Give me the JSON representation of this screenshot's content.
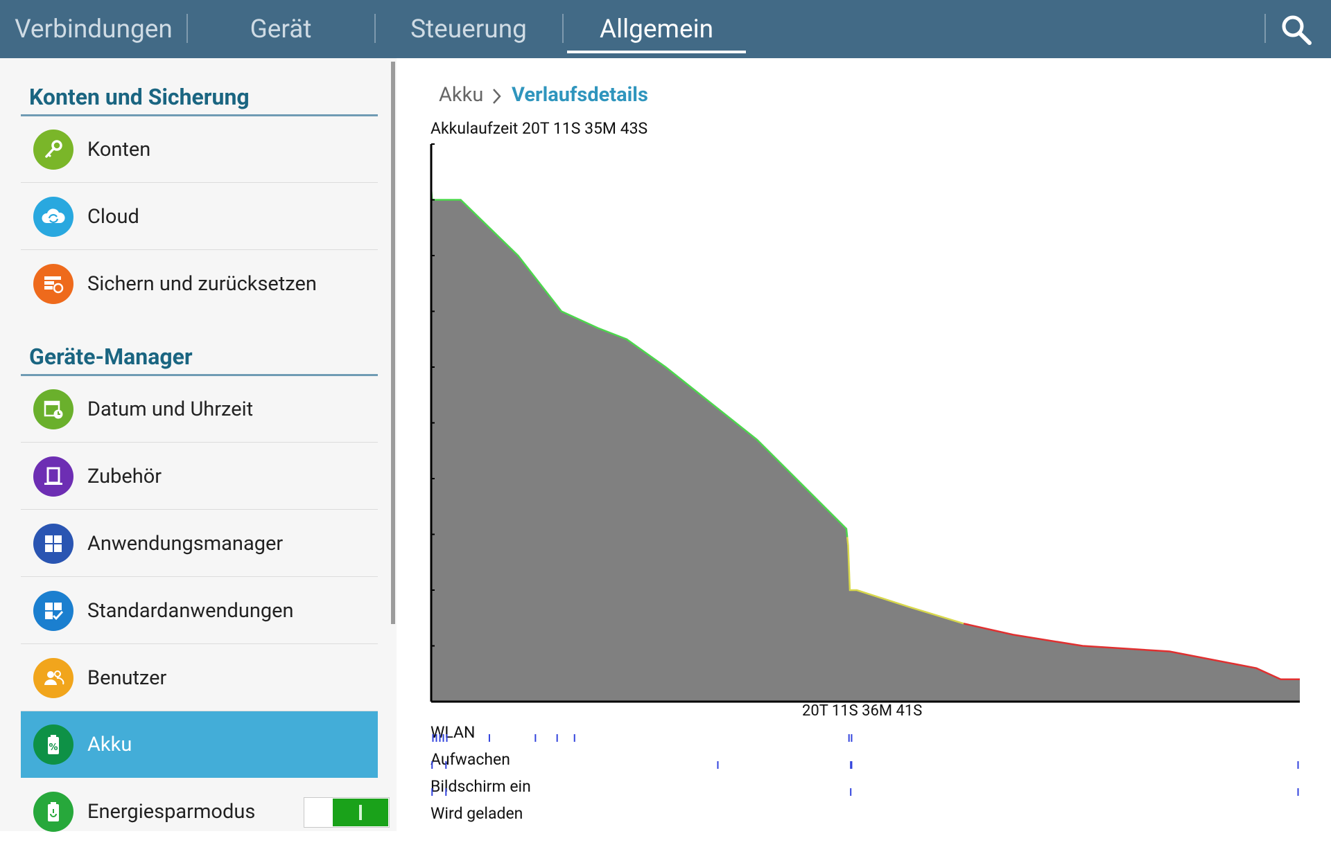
{
  "tabs": [
    {
      "label": "Verbindungen",
      "active": false
    },
    {
      "label": "Gerät",
      "active": false
    },
    {
      "label": "Steuerung",
      "active": false
    },
    {
      "label": "Allgemein",
      "active": true
    }
  ],
  "search_icon": "search-icon",
  "colors": {
    "tabbar": "#426a86",
    "section_title": "#1a6581",
    "selected_item": "#43add8",
    "breadcrumb_active": "#2f95bd",
    "chart_fill": "#808080",
    "charge_high": "#4cd84c",
    "charge_mid": "#d8d84c",
    "charge_low": "#e03030",
    "signal_bar": "#3344dd"
  },
  "sidebar": {
    "sections": [
      {
        "title": "Konten und Sicherung",
        "items": [
          {
            "label": "Konten",
            "icon": "key-icon",
            "color": "#7ab629"
          },
          {
            "label": "Cloud",
            "icon": "cloud-sync-icon",
            "color": "#29a8df"
          },
          {
            "label": "Sichern und zurücksetzen",
            "icon": "backup-restore-icon",
            "color": "#ee6a1c"
          }
        ]
      },
      {
        "title": "Geräte-Manager",
        "items": [
          {
            "label": "Datum und Uhrzeit",
            "icon": "calendar-clock-icon",
            "color": "#6ab02c"
          },
          {
            "label": "Zubehör",
            "icon": "accessory-icon",
            "color": "#6d2eb3"
          },
          {
            "label": "Anwendungsmanager",
            "icon": "grid-apps-icon",
            "color": "#2a55b2"
          },
          {
            "label": "Standardanwendungen",
            "icon": "default-apps-icon",
            "color": "#1b7fcf"
          },
          {
            "label": "Benutzer",
            "icon": "users-icon",
            "color": "#f1a51c"
          },
          {
            "label": "Akku",
            "icon": "battery-icon",
            "color": "#0e9146",
            "selected": true
          },
          {
            "label": "Energiesparmodus",
            "icon": "power-saving-icon",
            "color": "#27a83b",
            "toggle": true
          }
        ]
      }
    ]
  },
  "breadcrumb": {
    "parent": "Akku",
    "current": "Verlaufsdetails"
  },
  "akkulaufzeit": "Akkulaufzeit 20T 11S 35M 43S",
  "chart_data": {
    "type": "area",
    "title": "Akkulaufzeit 20T 11S 35M 43S",
    "xlabel": "20T 11S 36M 41S",
    "ylim": [
      0,
      100
    ],
    "x": [
      0,
      0.1,
      3.4,
      10,
      15,
      19.2,
      22.5,
      27,
      37.5,
      47.8,
      48,
      48.2,
      49,
      55,
      61.3,
      67,
      75,
      85,
      95,
      97.8,
      100
    ],
    "values": [
      92,
      90,
      90,
      80,
      70,
      67,
      65,
      60,
      47,
      31,
      28,
      20,
      20,
      17,
      14,
      12,
      10,
      9,
      6,
      4,
      4
    ],
    "segments": [
      {
        "from": 0,
        "to": 47.9,
        "level": "high"
      },
      {
        "from": 47.9,
        "to": 61.3,
        "level": "mid"
      },
      {
        "from": 61.3,
        "to": 100,
        "level": "low"
      }
    ],
    "signals": [
      {
        "name": "WLAN",
        "ticks": [
          0.2,
          0.6,
          1.0,
          1.4,
          1.8,
          6.7,
          12,
          14.5,
          16.5,
          48.1,
          48.4
        ]
      },
      {
        "name": "Aufwachen",
        "ticks": [
          0.1,
          1.7,
          33,
          48.3,
          48.4,
          99.8
        ]
      },
      {
        "name": "Bildschirm ein",
        "ticks": [
          0.1,
          1.7,
          48.3,
          99.8
        ]
      },
      {
        "name": "Wird geladen",
        "ticks": []
      }
    ]
  }
}
